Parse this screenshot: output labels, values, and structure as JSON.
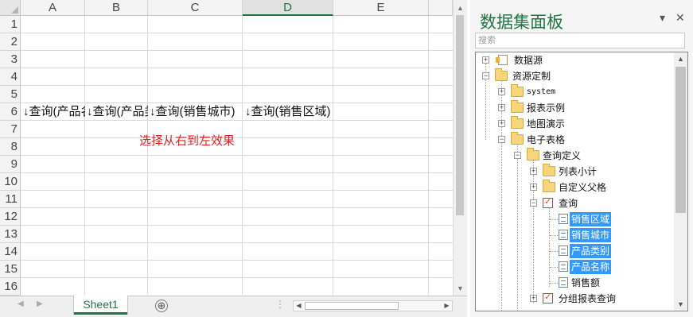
{
  "spreadsheet": {
    "columns": [
      "A",
      "B",
      "C",
      "D",
      "E"
    ],
    "rows": [
      "1",
      "2",
      "3",
      "4",
      "5",
      "6",
      "7",
      "8",
      "9",
      "10",
      "11",
      "12",
      "13",
      "14",
      "15",
      "16"
    ],
    "row6": [
      "↓查询(产品名称)",
      "↓查询(产品类别)",
      "↓查询(销售城市)",
      "↓查询(销售区域)"
    ],
    "note": "选择从右到左效果"
  },
  "tabs": {
    "sheet1": "Sheet1",
    "add": "⊕"
  },
  "panel": {
    "title": "数据集面板",
    "pin": "▾",
    "close": "✕",
    "search_placeholder": "搜索",
    "tree": [
      {
        "label": "数据源",
        "icon": "datasource-icon",
        "expander": "+"
      },
      {
        "label": "资源定制",
        "icon": "folder-icon",
        "expander": "−"
      },
      {
        "label": "system",
        "icon": "folder-icon",
        "expander": "+"
      },
      {
        "label": "报表示例",
        "icon": "folder-icon",
        "expander": "+"
      },
      {
        "label": "地图演示",
        "icon": "folder-icon",
        "expander": "+"
      },
      {
        "label": "电子表格",
        "icon": "folder-icon",
        "expander": "−"
      },
      {
        "label": "查询定义",
        "icon": "folder-icon",
        "expander": "−"
      },
      {
        "label": "列表小计",
        "icon": "folder-icon",
        "expander": "+"
      },
      {
        "label": "自定义父格",
        "icon": "folder-icon",
        "expander": "+"
      },
      {
        "label": "查询",
        "icon": "query-icon",
        "expander": "−"
      },
      {
        "label": "销售区域",
        "icon": "field-icon",
        "selected": true
      },
      {
        "label": "销售城市",
        "icon": "field-icon",
        "selected": true
      },
      {
        "label": "产品类别",
        "icon": "field-icon",
        "selected": true
      },
      {
        "label": "产品名称",
        "icon": "field-icon",
        "selected": true
      },
      {
        "label": "销售额",
        "icon": "field-icon",
        "selected": false
      },
      {
        "label": "分组报表查询",
        "icon": "query-icon",
        "expander": "+"
      }
    ]
  },
  "colors": {
    "accent": "#217346",
    "selection": "#3399ff",
    "note": "#e02020"
  }
}
